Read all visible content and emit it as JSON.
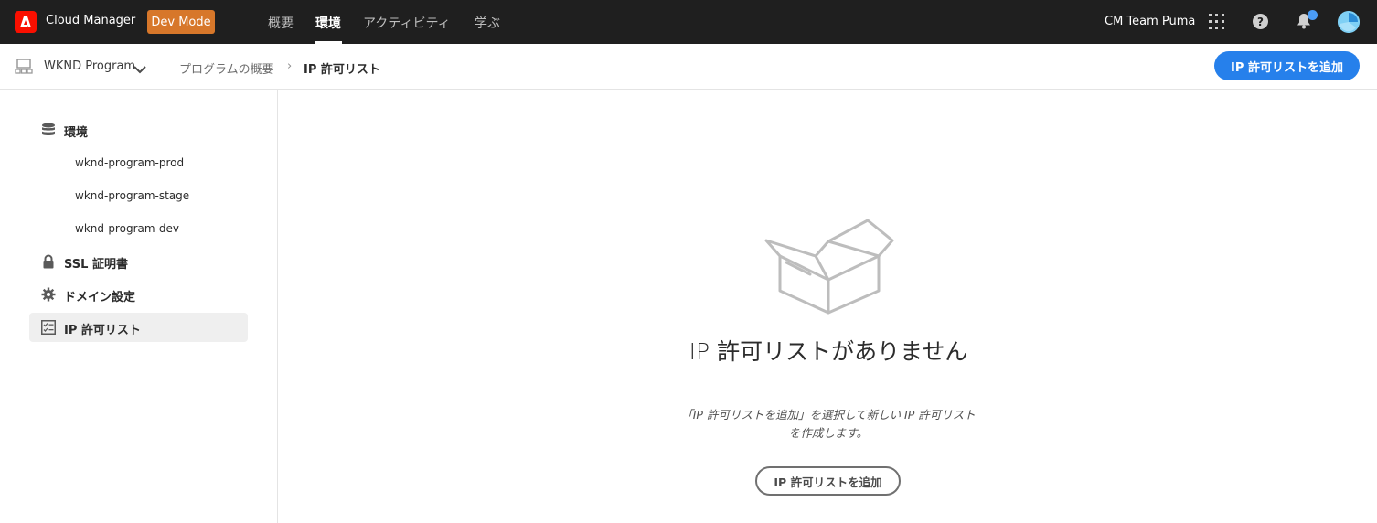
{
  "header": {
    "app_title": "Cloud Manager",
    "dev_mode": "Dev Mode",
    "tabs": [
      {
        "label": "概要"
      },
      {
        "label": "環境"
      },
      {
        "label": "アクティビティ"
      },
      {
        "label": "学ぶ"
      }
    ],
    "team": "CM Team Puma"
  },
  "subheader": {
    "program": "WKND Program",
    "breadcrumb": [
      "プログラムの概要",
      "IP 許可リスト"
    ],
    "add_button": "IP 許可リストを追加"
  },
  "sidebar": {
    "environments": {
      "label": "環境",
      "items": [
        "wknd-program-prod",
        "wknd-program-stage",
        "wknd-program-dev"
      ]
    },
    "ssl": "SSL 証明書",
    "domain": "ドメイン設定",
    "ip_allow": "IP 許可リスト"
  },
  "empty_state": {
    "title": "IP 許可リストがありません",
    "description": "「IP 許可リストを追加」を選択して新しい IP 許可リストを作成します。",
    "button": "IP 許可リストを追加"
  },
  "colors": {
    "topbar": "#1f1f1f",
    "accent": "#2680eb",
    "dev_mode": "#d7772a",
    "adobe_red": "#fa0f00"
  },
  "icons": [
    "adobe-logo-icon",
    "app-switcher-icon",
    "help-icon",
    "bell-icon",
    "avatar",
    "program-icon",
    "chevron-down-icon",
    "database-icon",
    "lock-icon",
    "gear-icon",
    "checklist-icon",
    "empty-box-icon"
  ]
}
